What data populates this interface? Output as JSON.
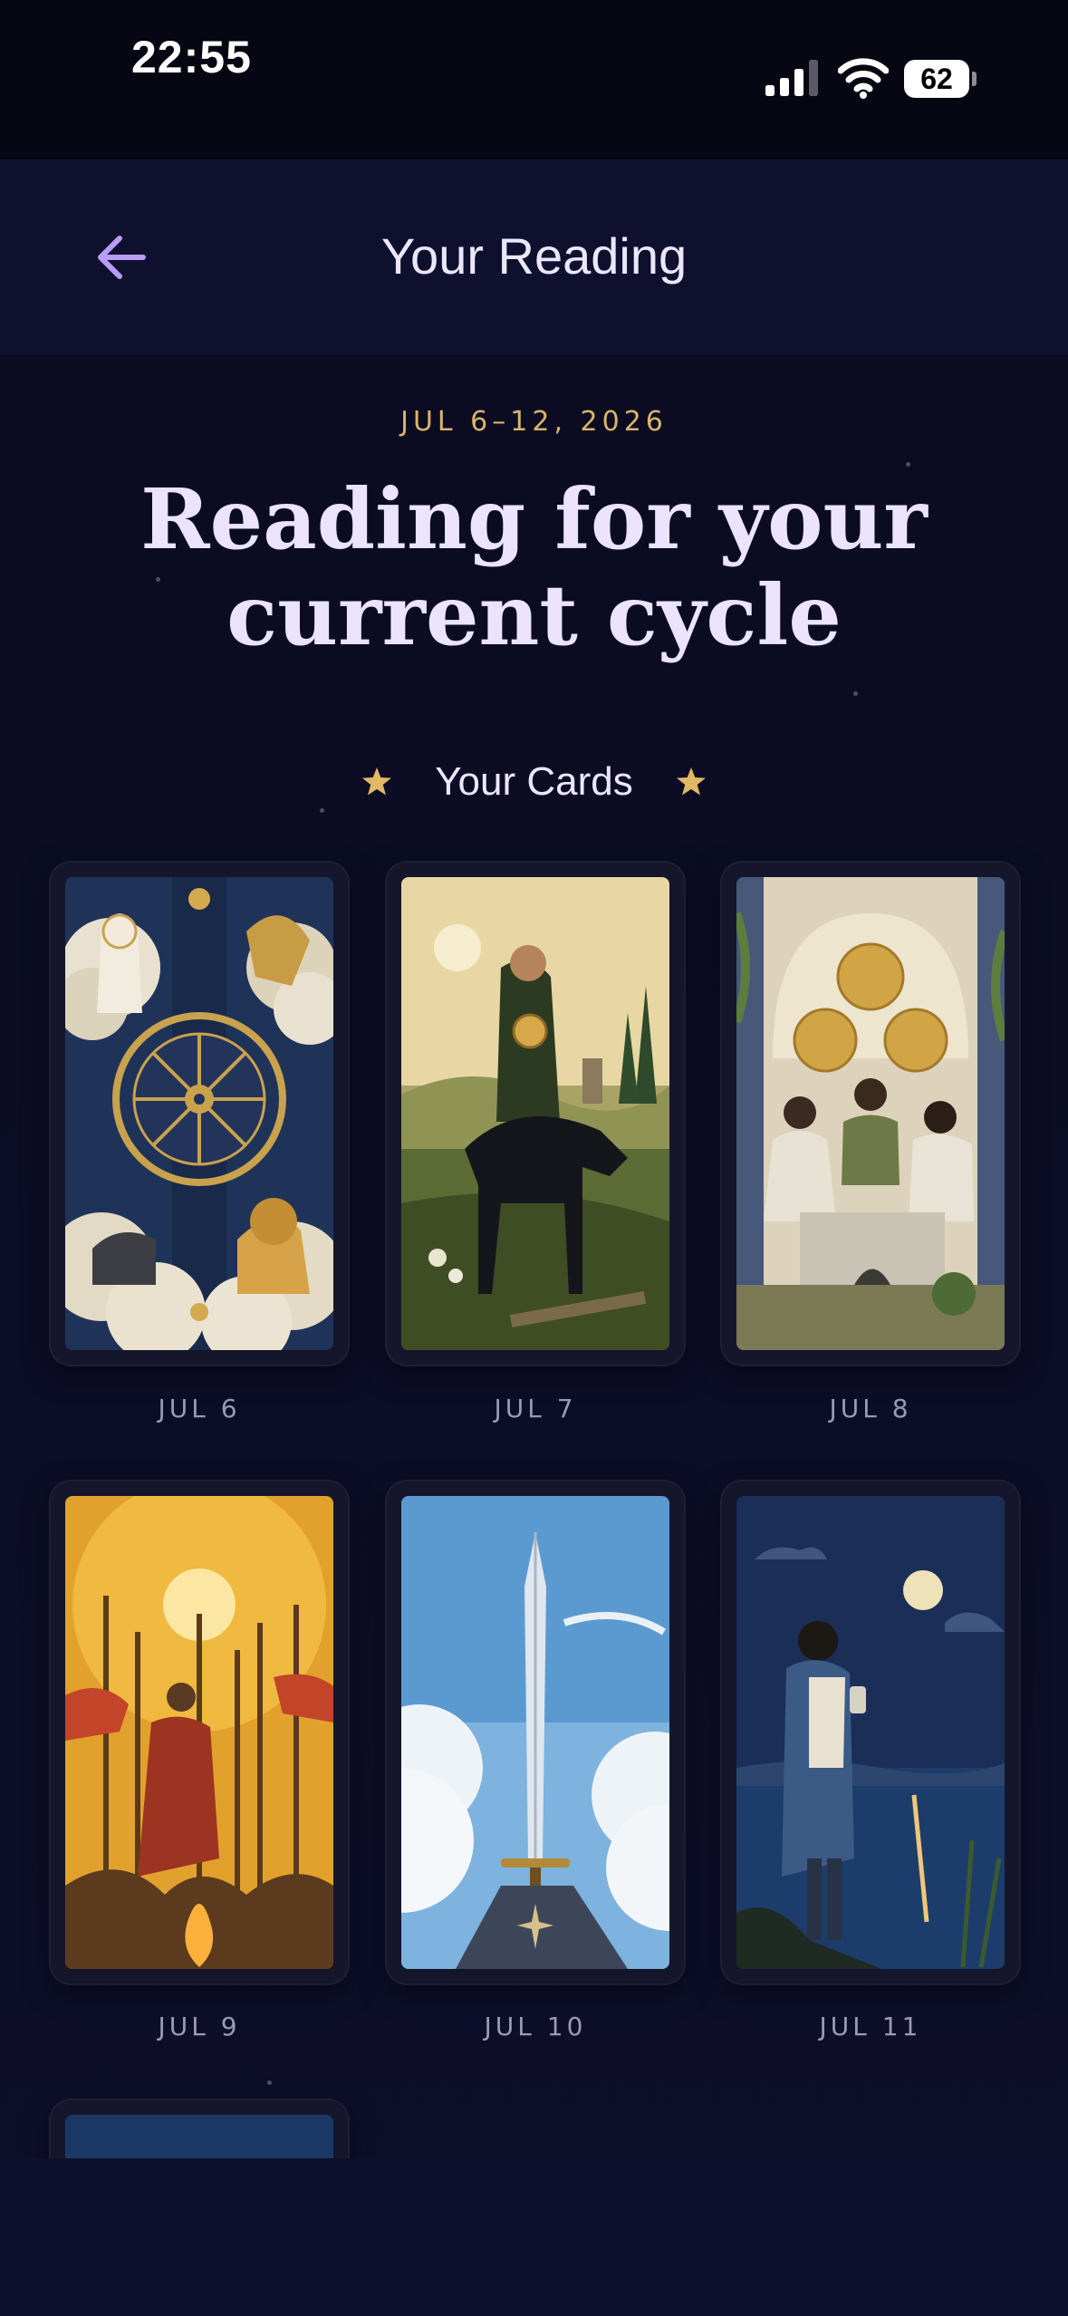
{
  "status_bar": {
    "time": "22:55",
    "battery": "62"
  },
  "header": {
    "title": "Your Reading",
    "back_icon": "arrow-left-icon"
  },
  "reading": {
    "date_range": "JUL 6–12, 2026",
    "title_line1": "Reading for your",
    "title_line2": "current cycle",
    "cards_heading": "Your Cards"
  },
  "cards": [
    {
      "date": "JUL 6",
      "art": "wheel-of-fortune"
    },
    {
      "date": "JUL 7",
      "art": "knight-of-pentacles"
    },
    {
      "date": "JUL 8",
      "art": "three-of-pentacles"
    },
    {
      "date": "JUL 9",
      "art": "six-of-wands"
    },
    {
      "date": "JUL 10",
      "art": "ace-of-swords"
    },
    {
      "date": "JUL 11",
      "art": "page-of-cups"
    },
    {
      "date": "",
      "art": "night-sky"
    }
  ],
  "colors": {
    "accent": "#d9b56a",
    "background": "#0a0b1e",
    "header": "#0f102d",
    "title": "#ebe3ff",
    "back_arrow": "#b89cf5"
  }
}
